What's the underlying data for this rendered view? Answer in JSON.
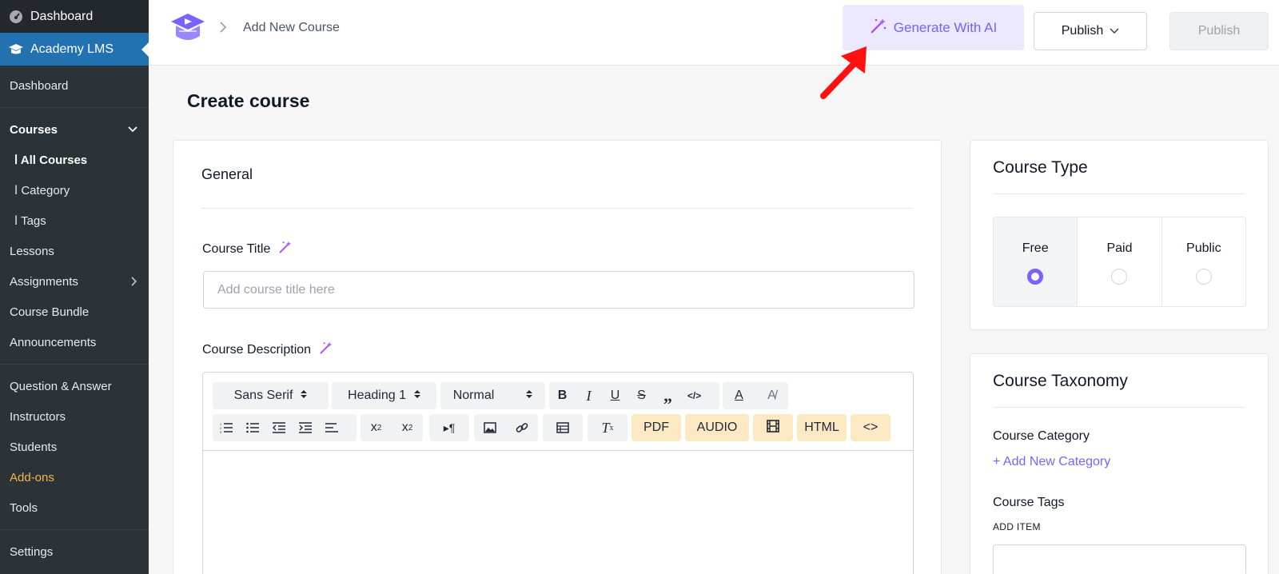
{
  "sidebar": {
    "dashboard_top": "Dashboard",
    "academy": "Academy LMS",
    "items": [
      {
        "label": "Dashboard"
      },
      {
        "label": "Courses"
      },
      {
        "label": "ⅼ All Courses"
      },
      {
        "label": "ⅼ Category"
      },
      {
        "label": "ⅼ Tags"
      },
      {
        "label": "Lessons"
      },
      {
        "label": "Assignments"
      },
      {
        "label": "Course Bundle"
      },
      {
        "label": "Announcements"
      },
      {
        "label": "Question & Answer"
      },
      {
        "label": "Instructors"
      },
      {
        "label": "Students"
      },
      {
        "label": "Add-ons"
      },
      {
        "label": "Tools"
      },
      {
        "label": "Settings"
      }
    ]
  },
  "header": {
    "breadcrumb": "Add New Course",
    "generate_ai": "Generate With AI",
    "publish_dropdown": "Publish",
    "publish": "Publish"
  },
  "page": {
    "title": "Create course"
  },
  "general": {
    "heading": "General",
    "course_title_label": "Course Title",
    "course_title_placeholder": "Add course title here",
    "course_title_value": "",
    "course_description_label": "Course Description"
  },
  "editor": {
    "font_select": "Sans Serif",
    "heading_select": "Heading 1",
    "size_select": "Normal",
    "tags": [
      "PDF",
      "AUDIO",
      "HTML",
      "<>"
    ]
  },
  "course_type": {
    "title": "Course Type",
    "options": [
      {
        "label": "Free",
        "selected": true
      },
      {
        "label": "Paid",
        "selected": false
      },
      {
        "label": "Public",
        "selected": false
      }
    ]
  },
  "taxonomy": {
    "title": "Course Taxonomy",
    "category_label": "Course Category",
    "add_category": "+ Add New Category",
    "tags_label": "Course Tags",
    "add_item": "ADD ITEM"
  },
  "colors": {
    "accent": "#7b61ff",
    "wp_blue": "#2271b1",
    "sidebar_bg": "#23282d",
    "addons_orange": "#f0b849",
    "arrow_red": "#ff1111"
  }
}
